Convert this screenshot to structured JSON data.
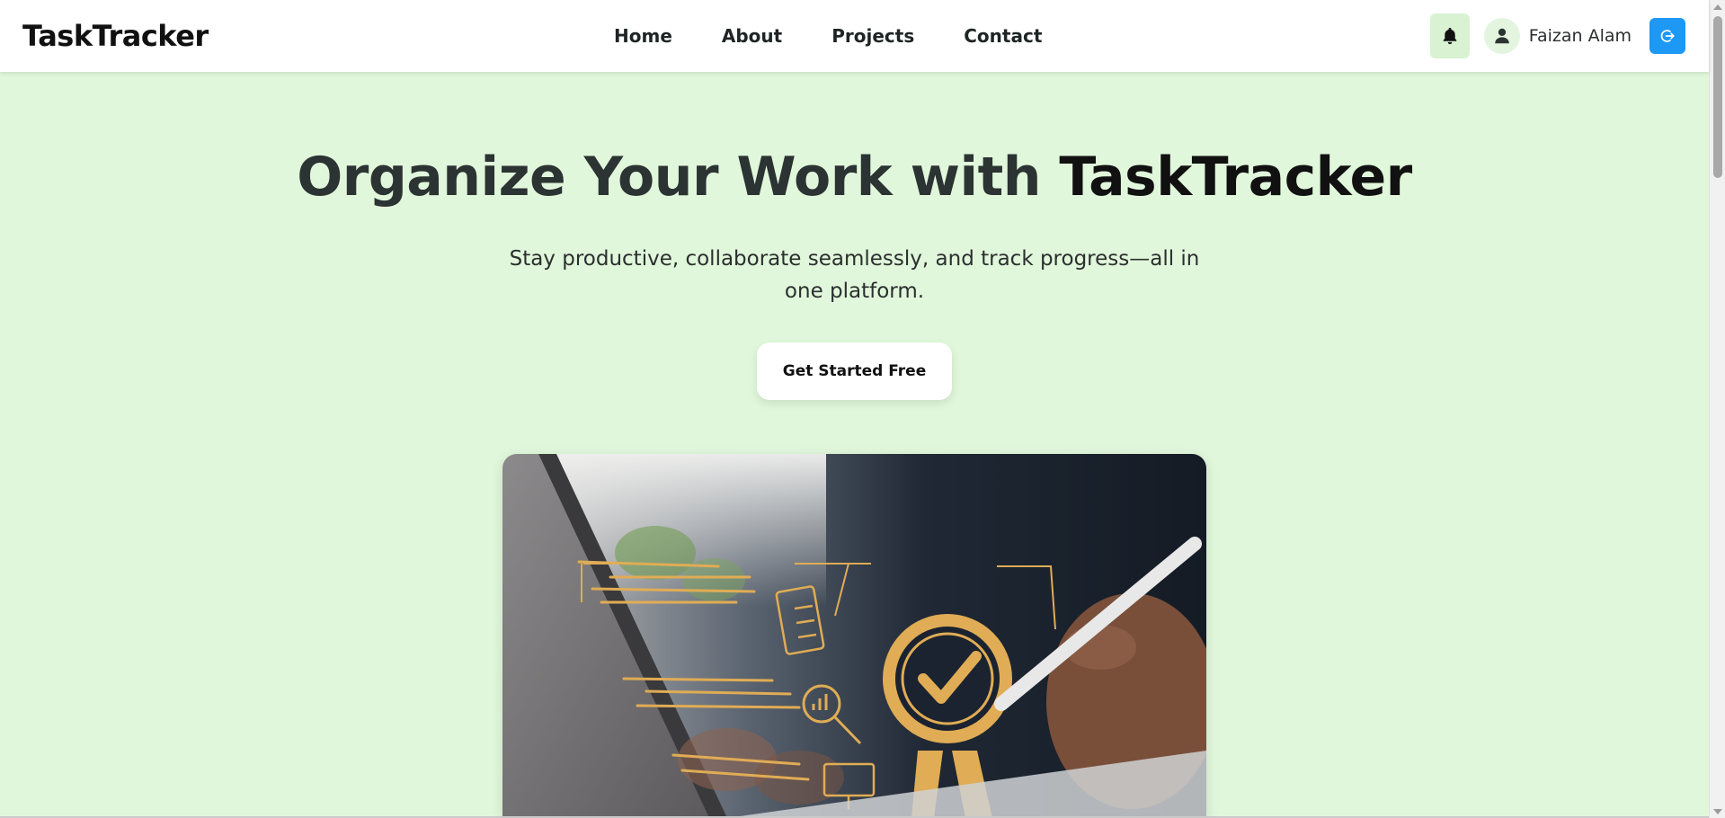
{
  "header": {
    "logo": "TaskTracker",
    "nav": [
      "Home",
      "About",
      "Projects",
      "Contact"
    ],
    "user_name": "Faizan Alam",
    "icons": {
      "notifications": "bell-icon",
      "avatar": "user-icon",
      "logout": "logout-icon"
    }
  },
  "hero": {
    "title_prefix": "Organize Your Work with ",
    "title_brand": "TaskTracker",
    "subtitle": "Stay productive, collaborate seamlessly, and track progress—all in one platform.",
    "cta_label": "Get Started Free"
  },
  "colors": {
    "background": "#e1f7db",
    "header": "#ffffff",
    "bell_button": "#d9f2d2",
    "logout_button": "#1e98f5",
    "illustration_gold": "#e0ac55"
  }
}
